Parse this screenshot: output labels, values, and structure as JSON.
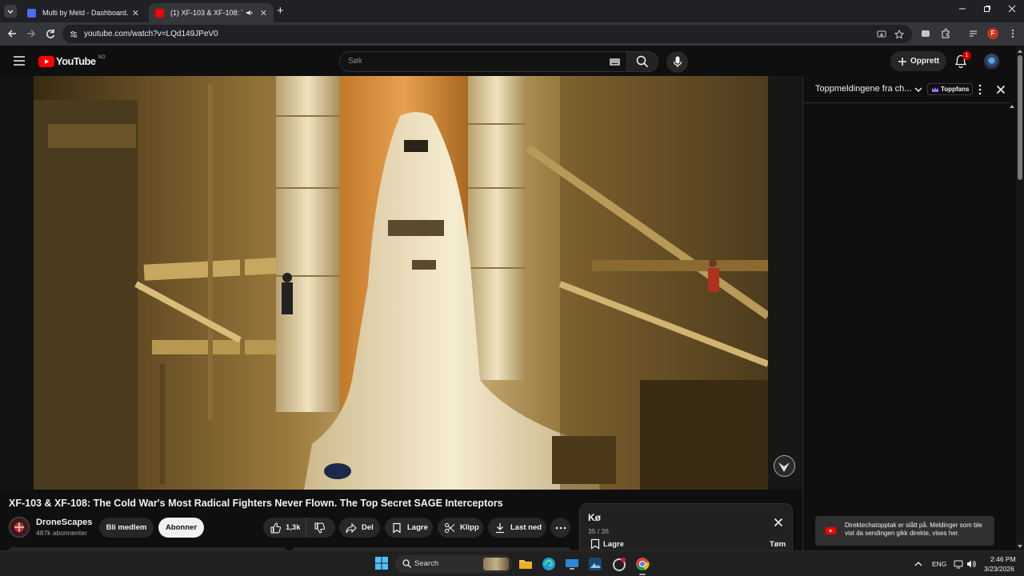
{
  "browser": {
    "tabs": [
      {
        "title": "Multi by Meld - Dashboard."
      },
      {
        "title": "(1) XF-103 & XF-108: The C"
      }
    ],
    "url": "youtube.com/watch?v=LQd149JPeV0"
  },
  "youtube": {
    "logo_text": "YouTube",
    "region": "NO",
    "search_placeholder": "Søk",
    "create_label": "Opprett",
    "notifications_count": "1",
    "avatar_letter": "F"
  },
  "video": {
    "title": "XF-103 & XF-108: The Cold War's Most Radical Fighters Never Flown. The Top Secret SAGE Interceptors",
    "channel": "DroneScapes",
    "subscribers": "487k abonnenter",
    "join_label": "Bli medlem",
    "subscribe_label": "Abonner",
    "likes": "1,3k",
    "share_label": "Del",
    "save_label": "Lagre",
    "clip_label": "Klipp",
    "download_label": "Last ned"
  },
  "chat": {
    "title": "Toppmeldingene fra ch...",
    "badge": "Toppfans"
  },
  "queue": {
    "title": "Kø",
    "position": "35 / 36",
    "save_label": "Lagre",
    "clear_label": "Tøm"
  },
  "toast": {
    "message": "Direktechatopptak er slått på. Meldinger som ble vist da sendingen gikk direkte, vises her."
  },
  "taskbar": {
    "search_label": "Search",
    "language": "ENG",
    "time": "2:46 PM",
    "date": "3/23/2026"
  },
  "colors": {
    "youtube_red": "#ff0000",
    "toppfans_purple": "#a06bff",
    "avatar_orange": "#c5361b"
  }
}
